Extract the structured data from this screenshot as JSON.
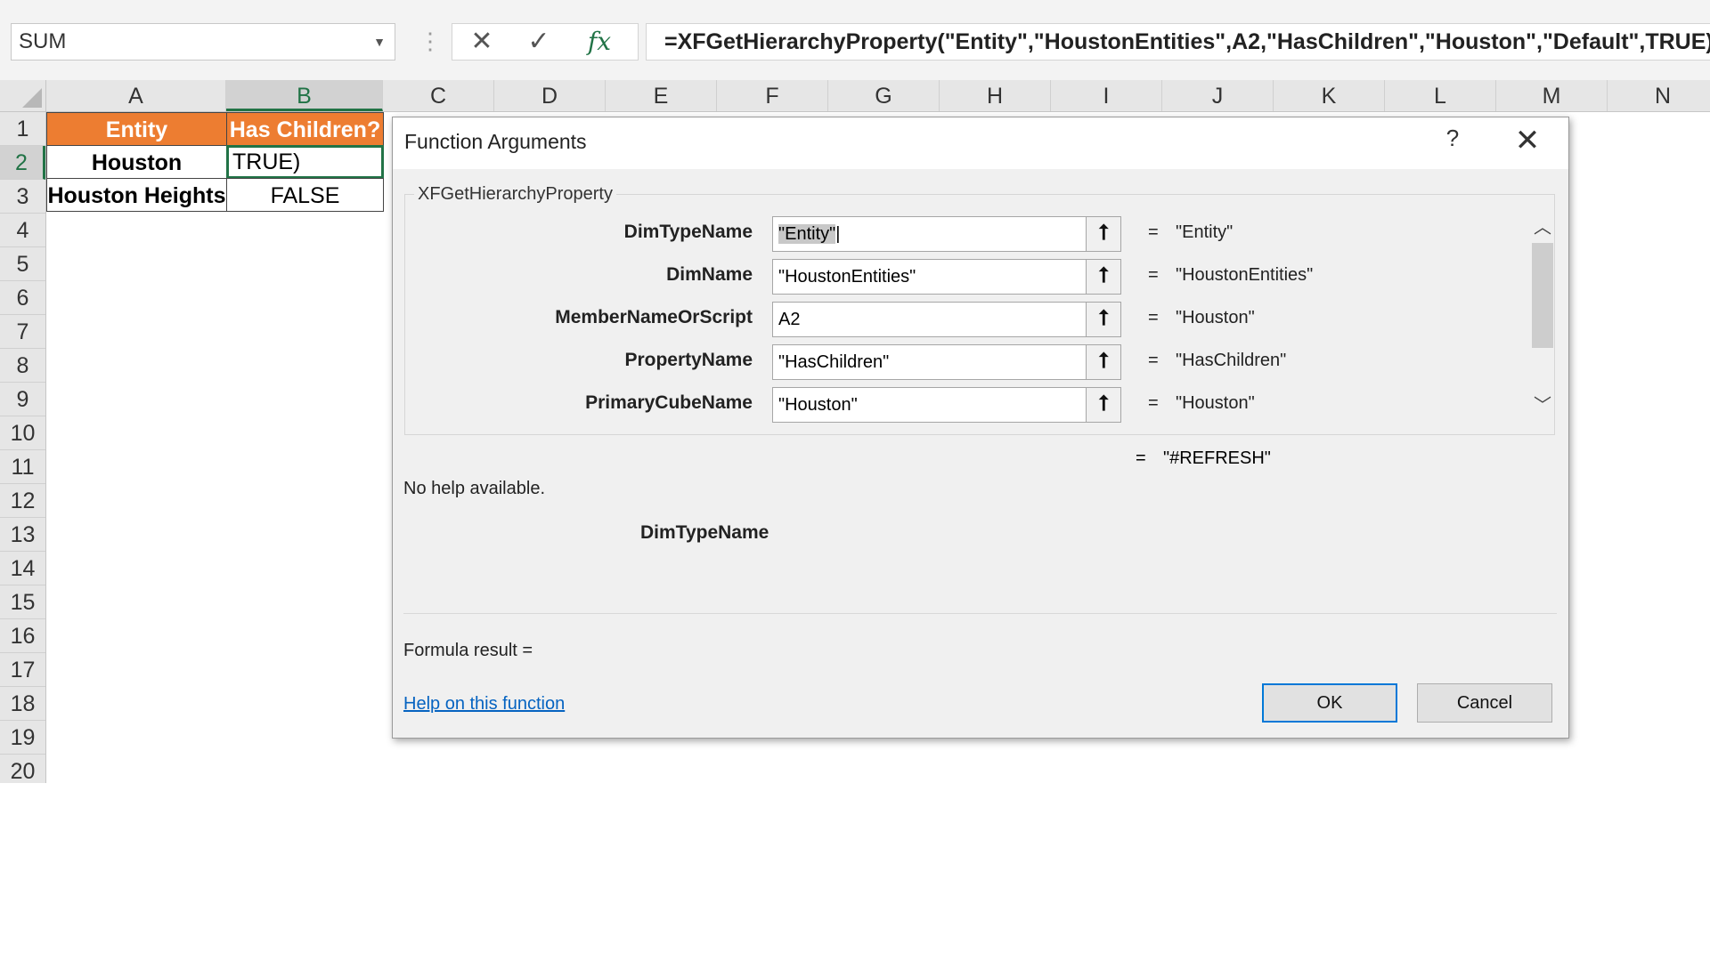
{
  "formula_bar": {
    "name_box": "SUM",
    "formula": "=XFGetHierarchyProperty(\"Entity\",\"HoustonEntities\",A2,\"HasChildren\",\"Houston\",\"Default\",TRUE)"
  },
  "columns": [
    "A",
    "B",
    "C",
    "D",
    "E",
    "F",
    "G",
    "H",
    "I",
    "J",
    "K",
    "L",
    "M",
    "N"
  ],
  "rows": [
    "1",
    "2",
    "3",
    "4",
    "5",
    "6",
    "7",
    "8",
    "9",
    "10",
    "11",
    "12",
    "13",
    "14",
    "15",
    "16",
    "17",
    "18",
    "19",
    "20"
  ],
  "cells": {
    "a1": "Entity",
    "b1": "Has Children?",
    "a2": "Houston",
    "b2": "TRUE)",
    "a3": "Houston Heights",
    "b3": "FALSE"
  },
  "colors": {
    "header_fill": "#ed7d31",
    "selection_green": "#217346",
    "link_blue": "#0563c1"
  },
  "dialog": {
    "title": "Function Arguments",
    "help_glyph": "?",
    "function_name": "XFGetHierarchyProperty",
    "arguments": [
      {
        "label": "DimTypeName",
        "value": "\"Entity\"",
        "result": "\"Entity\""
      },
      {
        "label": "DimName",
        "value": "\"HoustonEntities\"",
        "result": "\"HoustonEntities\""
      },
      {
        "label": "MemberNameOrScript",
        "value": "A2",
        "result": "\"Houston\""
      },
      {
        "label": "PropertyName",
        "value": "\"HasChildren\"",
        "result": "\"HasChildren\""
      },
      {
        "label": "PrimaryCubeName",
        "value": "\"Houston\"",
        "result": "\"Houston\""
      }
    ],
    "equals": "=",
    "overall_result": "\"#REFRESH\"",
    "help_text": "No help available.",
    "current_argument": "DimTypeName",
    "formula_result_label": "Formula result =",
    "help_link": "Help on this function",
    "ok_label": "OK",
    "cancel_label": "Cancel"
  }
}
